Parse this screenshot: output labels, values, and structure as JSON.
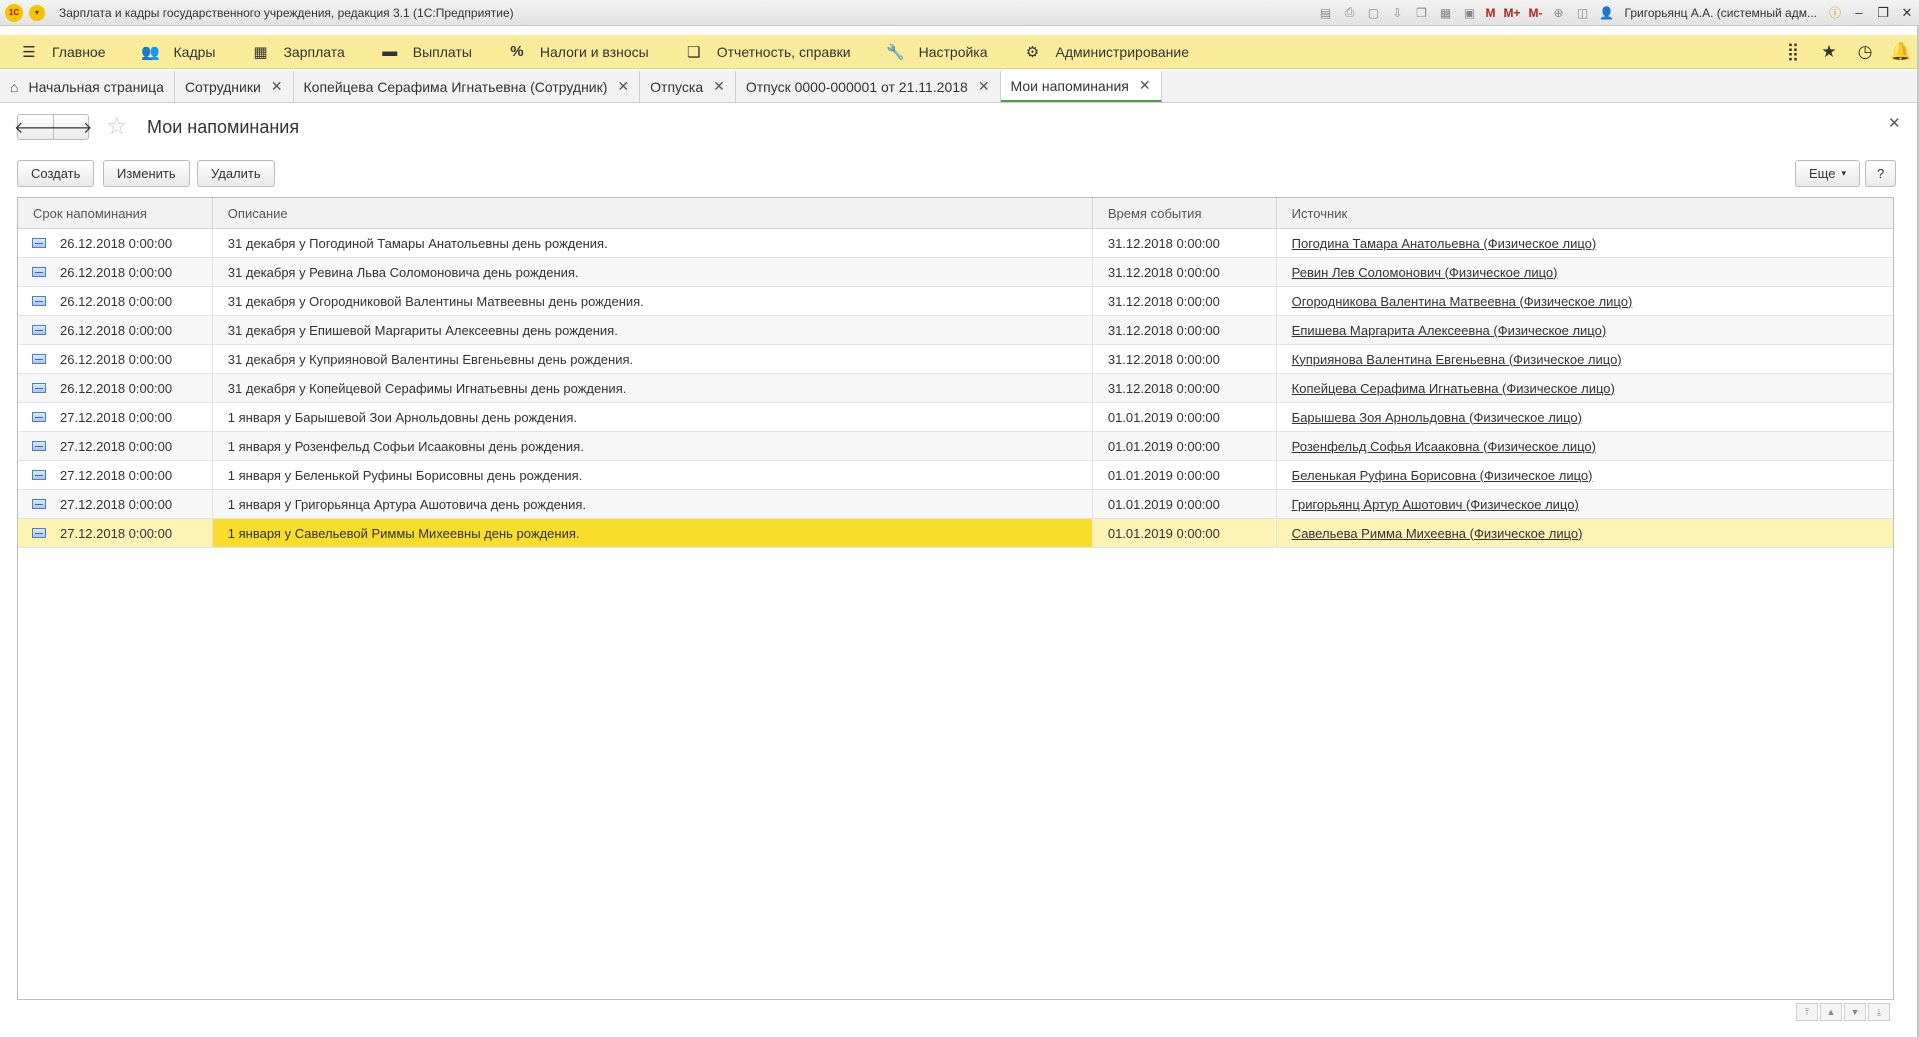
{
  "window": {
    "title": "Зарплата и кадры государственного учреждения, редакция 3.1  (1С:Предприятие)",
    "user": "Григорьянц А.А. (системный адм...",
    "toolbar_labels": {
      "m": "M",
      "mplus": "M+",
      "mminus": "M-"
    }
  },
  "main_menu": [
    {
      "label": "Главное",
      "icon": "hamburger-icon"
    },
    {
      "label": "Кадры",
      "icon": "people-icon"
    },
    {
      "label": "Зарплата",
      "icon": "calculator-icon"
    },
    {
      "label": "Выплаты",
      "icon": "wallet-icon"
    },
    {
      "label": "Налоги и взносы",
      "icon": "percent-icon"
    },
    {
      "label": "Отчетность, справки",
      "icon": "reports-icon"
    },
    {
      "label": "Настройка",
      "icon": "wrench-icon"
    },
    {
      "label": "Администрирование",
      "icon": "gear-icon"
    }
  ],
  "tabs": [
    {
      "label": "Начальная страница",
      "closable": false
    },
    {
      "label": "Сотрудники",
      "closable": true
    },
    {
      "label": "Копейцева Серафима Игнатьевна (Сотрудник)",
      "closable": true
    },
    {
      "label": "Отпуска",
      "closable": true
    },
    {
      "label": "Отпуск 0000-000001 от 21.11.2018",
      "closable": true
    },
    {
      "label": "Мои напоминания",
      "closable": true,
      "active": true
    }
  ],
  "form": {
    "title": "Мои напоминания",
    "buttons": {
      "create": "Создать",
      "edit": "Изменить",
      "delete": "Удалить",
      "more": "Еще",
      "help": "?"
    }
  },
  "table": {
    "columns": [
      "Срок напоминания",
      "Описание",
      "Время события",
      "Источник"
    ],
    "rows": [
      [
        "26.12.2018 0:00:00",
        "31 декабря у Погодиной Тамары Анатольевны день рождения.",
        "31.12.2018 0:00:00",
        "Погодина Тамара Анатольевна (Физическое лицо)"
      ],
      [
        "26.12.2018 0:00:00",
        "31 декабря у Ревина Льва Соломоновича день рождения.",
        "31.12.2018 0:00:00",
        "Ревин Лев Соломонович (Физическое лицо)"
      ],
      [
        "26.12.2018 0:00:00",
        "31 декабря у Огородниковой Валентины Матвеевны день рождения.",
        "31.12.2018 0:00:00",
        "Огородникова Валентина Матвеевна (Физическое лицо)"
      ],
      [
        "26.12.2018 0:00:00",
        "31 декабря у Епишевой Маргариты Алексеевны день рождения.",
        "31.12.2018 0:00:00",
        "Епишева Маргарита Алексеевна (Физическое лицо)"
      ],
      [
        "26.12.2018 0:00:00",
        "31 декабря у Куприяновой Валентины Евгеньевны день рождения.",
        "31.12.2018 0:00:00",
        "Куприянова Валентина Евгеньевна (Физическое лицо)"
      ],
      [
        "26.12.2018 0:00:00",
        "31 декабря у Копейцевой Серафимы Игнатьевны день рождения.",
        "31.12.2018 0:00:00",
        "Копейцева Серафима Игнатьевна (Физическое лицо)"
      ],
      [
        "27.12.2018 0:00:00",
        "1 января у Барышевой Зои Арнольдовны день рождения.",
        "01.01.2019 0:00:00",
        "Барышева Зоя Арнольдовна (Физическое лицо)"
      ],
      [
        "27.12.2018 0:00:00",
        "1 января у Розенфельд Софьи Исааковны день рождения.",
        "01.01.2019 0:00:00",
        "Розенфельд Софья Исааковна (Физическое лицо)"
      ],
      [
        "27.12.2018 0:00:00",
        "1 января у Беленькой Руфины Борисовны день рождения.",
        "01.01.2019 0:00:00",
        "Беленькая Руфина Борисовна (Физическое лицо)"
      ],
      [
        "27.12.2018 0:00:00",
        "1 января у Григорьянца Артура Ашотовича день рождения.",
        "01.01.2019 0:00:00",
        "Григорьянц Артур Ашотович (Физическое лицо)"
      ],
      [
        "27.12.2018 0:00:00",
        "1 января у Савельевой Риммы Михеевны день рождения.",
        "01.01.2019 0:00:00",
        "Савельева Римма Михеевна (Физическое лицо)"
      ]
    ],
    "selected_row": 10
  },
  "colors": {
    "menu_bg": "#fbec9c",
    "selected_row": "#fcf3b5",
    "selected_cell": "#f8dd2b",
    "active_tab_underline": "#4f9a4f"
  }
}
